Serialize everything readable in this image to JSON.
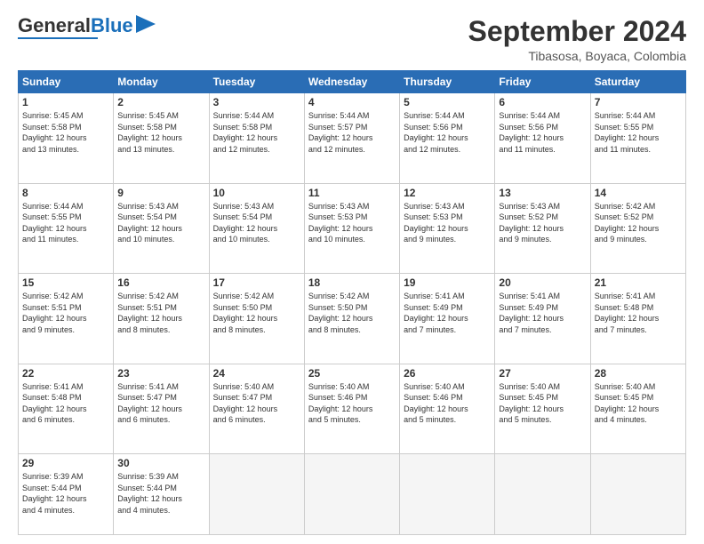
{
  "header": {
    "logo_general": "General",
    "logo_blue": "Blue",
    "month_year": "September 2024",
    "location": "Tibasosa, Boyaca, Colombia"
  },
  "columns": [
    "Sunday",
    "Monday",
    "Tuesday",
    "Wednesday",
    "Thursday",
    "Friday",
    "Saturday"
  ],
  "weeks": [
    [
      {
        "day": "1",
        "info": "Sunrise: 5:45 AM\nSunset: 5:58 PM\nDaylight: 12 hours\nand 13 minutes."
      },
      {
        "day": "2",
        "info": "Sunrise: 5:45 AM\nSunset: 5:58 PM\nDaylight: 12 hours\nand 13 minutes."
      },
      {
        "day": "3",
        "info": "Sunrise: 5:44 AM\nSunset: 5:58 PM\nDaylight: 12 hours\nand 12 minutes."
      },
      {
        "day": "4",
        "info": "Sunrise: 5:44 AM\nSunset: 5:57 PM\nDaylight: 12 hours\nand 12 minutes."
      },
      {
        "day": "5",
        "info": "Sunrise: 5:44 AM\nSunset: 5:56 PM\nDaylight: 12 hours\nand 12 minutes."
      },
      {
        "day": "6",
        "info": "Sunrise: 5:44 AM\nSunset: 5:56 PM\nDaylight: 12 hours\nand 11 minutes."
      },
      {
        "day": "7",
        "info": "Sunrise: 5:44 AM\nSunset: 5:55 PM\nDaylight: 12 hours\nand 11 minutes."
      }
    ],
    [
      {
        "day": "8",
        "info": "Sunrise: 5:44 AM\nSunset: 5:55 PM\nDaylight: 12 hours\nand 11 minutes."
      },
      {
        "day": "9",
        "info": "Sunrise: 5:43 AM\nSunset: 5:54 PM\nDaylight: 12 hours\nand 10 minutes."
      },
      {
        "day": "10",
        "info": "Sunrise: 5:43 AM\nSunset: 5:54 PM\nDaylight: 12 hours\nand 10 minutes."
      },
      {
        "day": "11",
        "info": "Sunrise: 5:43 AM\nSunset: 5:53 PM\nDaylight: 12 hours\nand 10 minutes."
      },
      {
        "day": "12",
        "info": "Sunrise: 5:43 AM\nSunset: 5:53 PM\nDaylight: 12 hours\nand 9 minutes."
      },
      {
        "day": "13",
        "info": "Sunrise: 5:43 AM\nSunset: 5:52 PM\nDaylight: 12 hours\nand 9 minutes."
      },
      {
        "day": "14",
        "info": "Sunrise: 5:42 AM\nSunset: 5:52 PM\nDaylight: 12 hours\nand 9 minutes."
      }
    ],
    [
      {
        "day": "15",
        "info": "Sunrise: 5:42 AM\nSunset: 5:51 PM\nDaylight: 12 hours\nand 9 minutes."
      },
      {
        "day": "16",
        "info": "Sunrise: 5:42 AM\nSunset: 5:51 PM\nDaylight: 12 hours\nand 8 minutes."
      },
      {
        "day": "17",
        "info": "Sunrise: 5:42 AM\nSunset: 5:50 PM\nDaylight: 12 hours\nand 8 minutes."
      },
      {
        "day": "18",
        "info": "Sunrise: 5:42 AM\nSunset: 5:50 PM\nDaylight: 12 hours\nand 8 minutes."
      },
      {
        "day": "19",
        "info": "Sunrise: 5:41 AM\nSunset: 5:49 PM\nDaylight: 12 hours\nand 7 minutes."
      },
      {
        "day": "20",
        "info": "Sunrise: 5:41 AM\nSunset: 5:49 PM\nDaylight: 12 hours\nand 7 minutes."
      },
      {
        "day": "21",
        "info": "Sunrise: 5:41 AM\nSunset: 5:48 PM\nDaylight: 12 hours\nand 7 minutes."
      }
    ],
    [
      {
        "day": "22",
        "info": "Sunrise: 5:41 AM\nSunset: 5:48 PM\nDaylight: 12 hours\nand 6 minutes."
      },
      {
        "day": "23",
        "info": "Sunrise: 5:41 AM\nSunset: 5:47 PM\nDaylight: 12 hours\nand 6 minutes."
      },
      {
        "day": "24",
        "info": "Sunrise: 5:40 AM\nSunset: 5:47 PM\nDaylight: 12 hours\nand 6 minutes."
      },
      {
        "day": "25",
        "info": "Sunrise: 5:40 AM\nSunset: 5:46 PM\nDaylight: 12 hours\nand 5 minutes."
      },
      {
        "day": "26",
        "info": "Sunrise: 5:40 AM\nSunset: 5:46 PM\nDaylight: 12 hours\nand 5 minutes."
      },
      {
        "day": "27",
        "info": "Sunrise: 5:40 AM\nSunset: 5:45 PM\nDaylight: 12 hours\nand 5 minutes."
      },
      {
        "day": "28",
        "info": "Sunrise: 5:40 AM\nSunset: 5:45 PM\nDaylight: 12 hours\nand 4 minutes."
      }
    ],
    [
      {
        "day": "29",
        "info": "Sunrise: 5:39 AM\nSunset: 5:44 PM\nDaylight: 12 hours\nand 4 minutes."
      },
      {
        "day": "30",
        "info": "Sunrise: 5:39 AM\nSunset: 5:44 PM\nDaylight: 12 hours\nand 4 minutes."
      },
      {
        "day": "",
        "info": ""
      },
      {
        "day": "",
        "info": ""
      },
      {
        "day": "",
        "info": ""
      },
      {
        "day": "",
        "info": ""
      },
      {
        "day": "",
        "info": ""
      }
    ]
  ]
}
